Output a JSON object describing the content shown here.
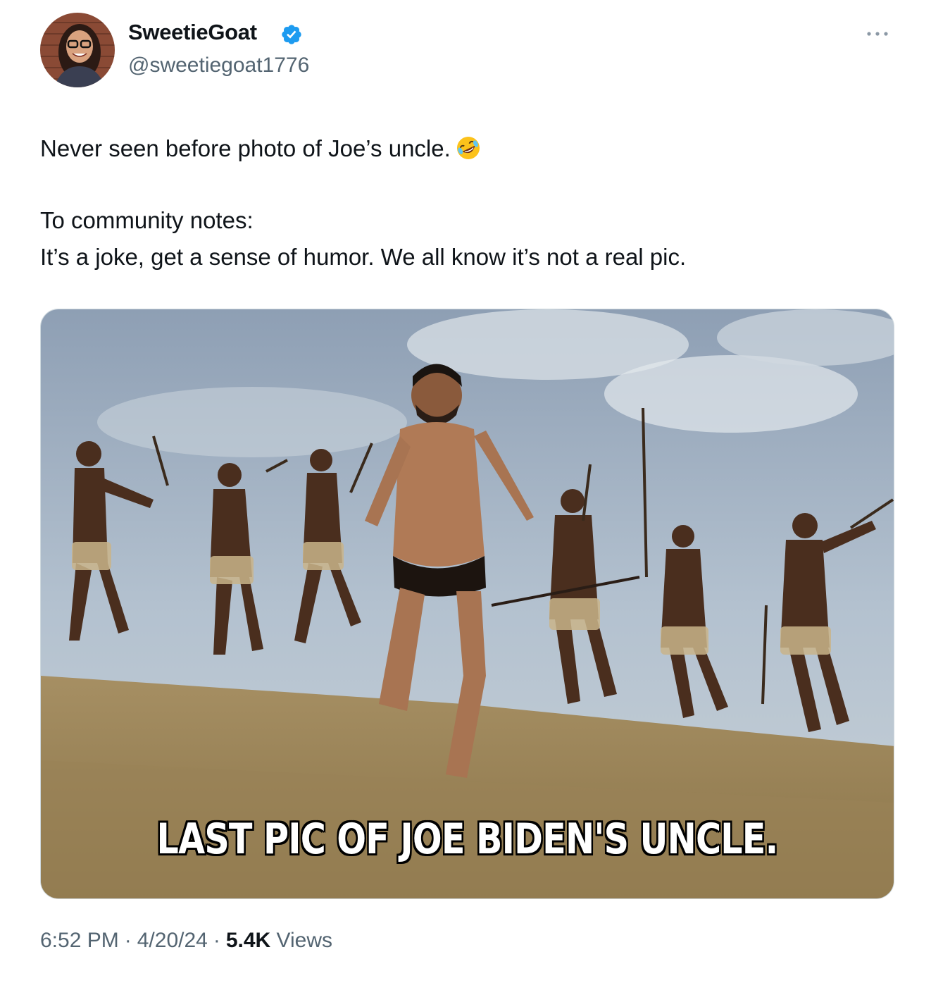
{
  "author": {
    "display_name": "SweetieGoat",
    "handle": "@sweetiegoat1776",
    "verified_color": "#1d9bf0"
  },
  "tweet": {
    "line1": "Never seen before photo of Joe’s uncle.",
    "line1_emoji": "rolling-on-the-floor-laughing-emoji",
    "line2": "To community notes:",
    "line3": "It’s a joke, get a sense of humor. We all know it’s not a real pic."
  },
  "media": {
    "caption": "LAST PIC OF JOE BIDEN'S UNCLE."
  },
  "meta": {
    "time": "6:52 PM",
    "separator": "·",
    "date": "4/20/24",
    "views_count": "5.4K",
    "views_label": "Views"
  },
  "icons": {
    "more": "more-horizontal-icon",
    "verified": "verified-badge-icon"
  },
  "colors": {
    "text_primary": "#0f1419",
    "text_secondary": "#536471",
    "accent": "#1d9bf0"
  }
}
